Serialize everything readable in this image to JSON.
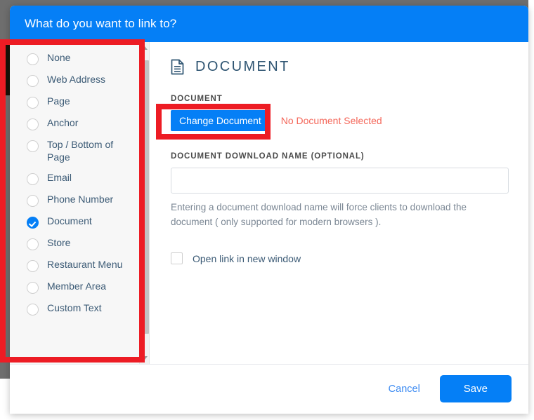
{
  "modal": {
    "title": "What do you want to link to?"
  },
  "sidebar": {
    "options": [
      {
        "label": "None",
        "selected": false
      },
      {
        "label": "Web Address",
        "selected": false
      },
      {
        "label": "Page",
        "selected": false
      },
      {
        "label": "Anchor",
        "selected": false
      },
      {
        "label": "Top / Bottom of Page",
        "selected": false
      },
      {
        "label": "Email",
        "selected": false
      },
      {
        "label": "Phone Number",
        "selected": false
      },
      {
        "label": "Document",
        "selected": true
      },
      {
        "label": "Store",
        "selected": false
      },
      {
        "label": "Restaurant Menu",
        "selected": false
      },
      {
        "label": "Member Area",
        "selected": false
      },
      {
        "label": "Custom Text",
        "selected": false
      }
    ]
  },
  "content": {
    "heading": "DOCUMENT",
    "heading_icon": "document-icon",
    "document_section_label": "DOCUMENT",
    "change_document_button": "Change Document",
    "document_status": "No Document Selected",
    "download_name_label": "DOCUMENT DOWNLOAD NAME (OPTIONAL)",
    "download_name_value": "",
    "download_name_placeholder": "",
    "helper_text": "Entering a document download name will force clients to download the document ( only supported for modern browsers ).",
    "open_new_window_label": "Open link in new window",
    "open_new_window_checked": false
  },
  "footer": {
    "cancel_label": "Cancel",
    "save_label": "Save"
  },
  "colors": {
    "accent_blue": "#057FF6",
    "status_red": "#f4675a",
    "annotation_red": "#ED1C24",
    "label_text": "#3b5a75"
  }
}
